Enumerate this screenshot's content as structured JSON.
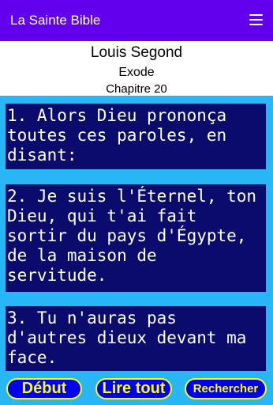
{
  "appbar": {
    "title": "La Sainte Bible",
    "menu_icon": "hamburger-menu-icon"
  },
  "colors": {
    "appbar": "#6200ee",
    "content_background": "#29b6f6",
    "verse_background": "#0b0b6e",
    "verse_text": "#ffffff",
    "button_background": "#0000ee",
    "button_text": "#ffff00"
  },
  "header": {
    "version": "Louis Segond",
    "book": "Exode",
    "chapter": "Chapitre 20"
  },
  "verses": [
    {
      "text": "1. Alors Dieu prononça toutes ces paroles, en disant:"
    },
    {
      "text": "2. Je suis l'Éternel, ton Dieu, qui t'ai fait sortir du pays d'Égypte, de la maison de servitude."
    },
    {
      "text": "3. Tu n'auras pas d'autres dieux devant ma face."
    }
  ],
  "buttons": {
    "start": "Début",
    "read_all": "Lire tout",
    "search": "Rechercher"
  }
}
